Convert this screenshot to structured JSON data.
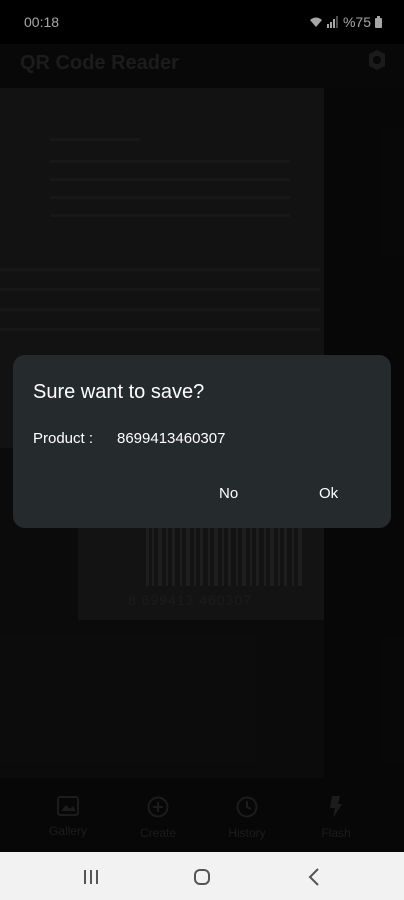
{
  "status_bar": {
    "time": "00:18",
    "battery": "%75"
  },
  "app_bar": {
    "title": "QR Code Reader"
  },
  "camera": {
    "barcode_digits": "8 699413 460307"
  },
  "dialog": {
    "title": "Sure want to save?",
    "product_label": "Product :",
    "product_value": "8699413460307",
    "no_label": "No",
    "ok_label": "Ok"
  },
  "bottom_nav": {
    "items": [
      {
        "label": "Gallery",
        "icon": "gallery-icon"
      },
      {
        "label": "Create",
        "icon": "create-icon"
      },
      {
        "label": "History",
        "icon": "history-icon"
      },
      {
        "label": "Flash",
        "icon": "flash-icon"
      }
    ]
  },
  "colors": {
    "dialog_bg": "#252a2d",
    "text": "#ffffff",
    "dim_text": "#2b2b2b"
  }
}
